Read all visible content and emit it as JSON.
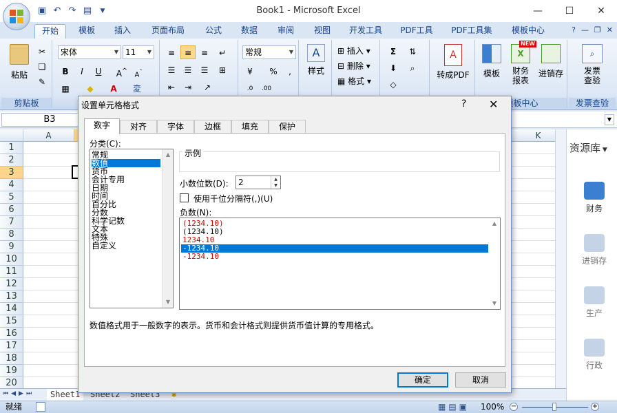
{
  "window": {
    "title": "Book1 - Microsoft Excel"
  },
  "ribbon": {
    "tabs": [
      "开始",
      "模板",
      "插入",
      "页面布局",
      "公式",
      "数据",
      "审阅",
      "视图",
      "开发工具",
      "PDF工具",
      "PDF工具集",
      "模板中心"
    ],
    "clipboard": {
      "paste": "粘贴",
      "group": "剪贴板"
    },
    "font": {
      "name": "宋体",
      "size": "11",
      "bold": "B",
      "italic": "I",
      "underline": "U"
    },
    "number_format": "常规",
    "styles": "样式",
    "cells": {
      "insert": "插入",
      "delete": "删除",
      "format": "格式"
    },
    "to_pdf": "转成PDF",
    "template_center": {
      "template": "模板",
      "finance_report": "财务报表",
      "purchase_sales": "进销存",
      "badge": "NEW",
      "group": "模板中心"
    },
    "invoice": {
      "label": "发票查验",
      "group": "发票查验"
    }
  },
  "formula_bar": {
    "name_box": "B3"
  },
  "grid": {
    "columns": [
      "A",
      "K"
    ],
    "rows": [
      "1",
      "2",
      "3",
      "4",
      "5",
      "6",
      "7",
      "8",
      "9",
      "10",
      "11",
      "12",
      "13",
      "14",
      "15",
      "16",
      "17",
      "18",
      "19",
      "20"
    ]
  },
  "sheets": [
    "Sheet1",
    "Sheet2",
    "Sheet3"
  ],
  "status": {
    "ready": "就绪",
    "zoom": "100%"
  },
  "resource_panel": {
    "title": "资源库",
    "items": [
      "财务",
      "进销存",
      "生产",
      "行政"
    ]
  },
  "dialog": {
    "title": "设置单元格格式",
    "help": "?",
    "tabs": [
      "数字",
      "对齐",
      "字体",
      "边框",
      "填充",
      "保护"
    ],
    "category_label": "分类(C):",
    "categories": [
      "常规",
      "数值",
      "货币",
      "会计专用",
      "日期",
      "时间",
      "百分比",
      "分数",
      "科学记数",
      "文本",
      "特殊",
      "自定义"
    ],
    "sample_label": "示例",
    "decimal_label": "小数位数(D):",
    "decimal_value": "2",
    "thousands_label": "使用千位分隔符(,)(U)",
    "negative_label": "负数(N):",
    "negatives": [
      "(1234.10)",
      "(1234.10)",
      "1234.10",
      "-1234.10",
      "-1234.10"
    ],
    "description": "数值格式用于一般数字的表示。货币和会计格式则提供货币值计算的专用格式。",
    "ok": "确定",
    "cancel": "取消"
  }
}
